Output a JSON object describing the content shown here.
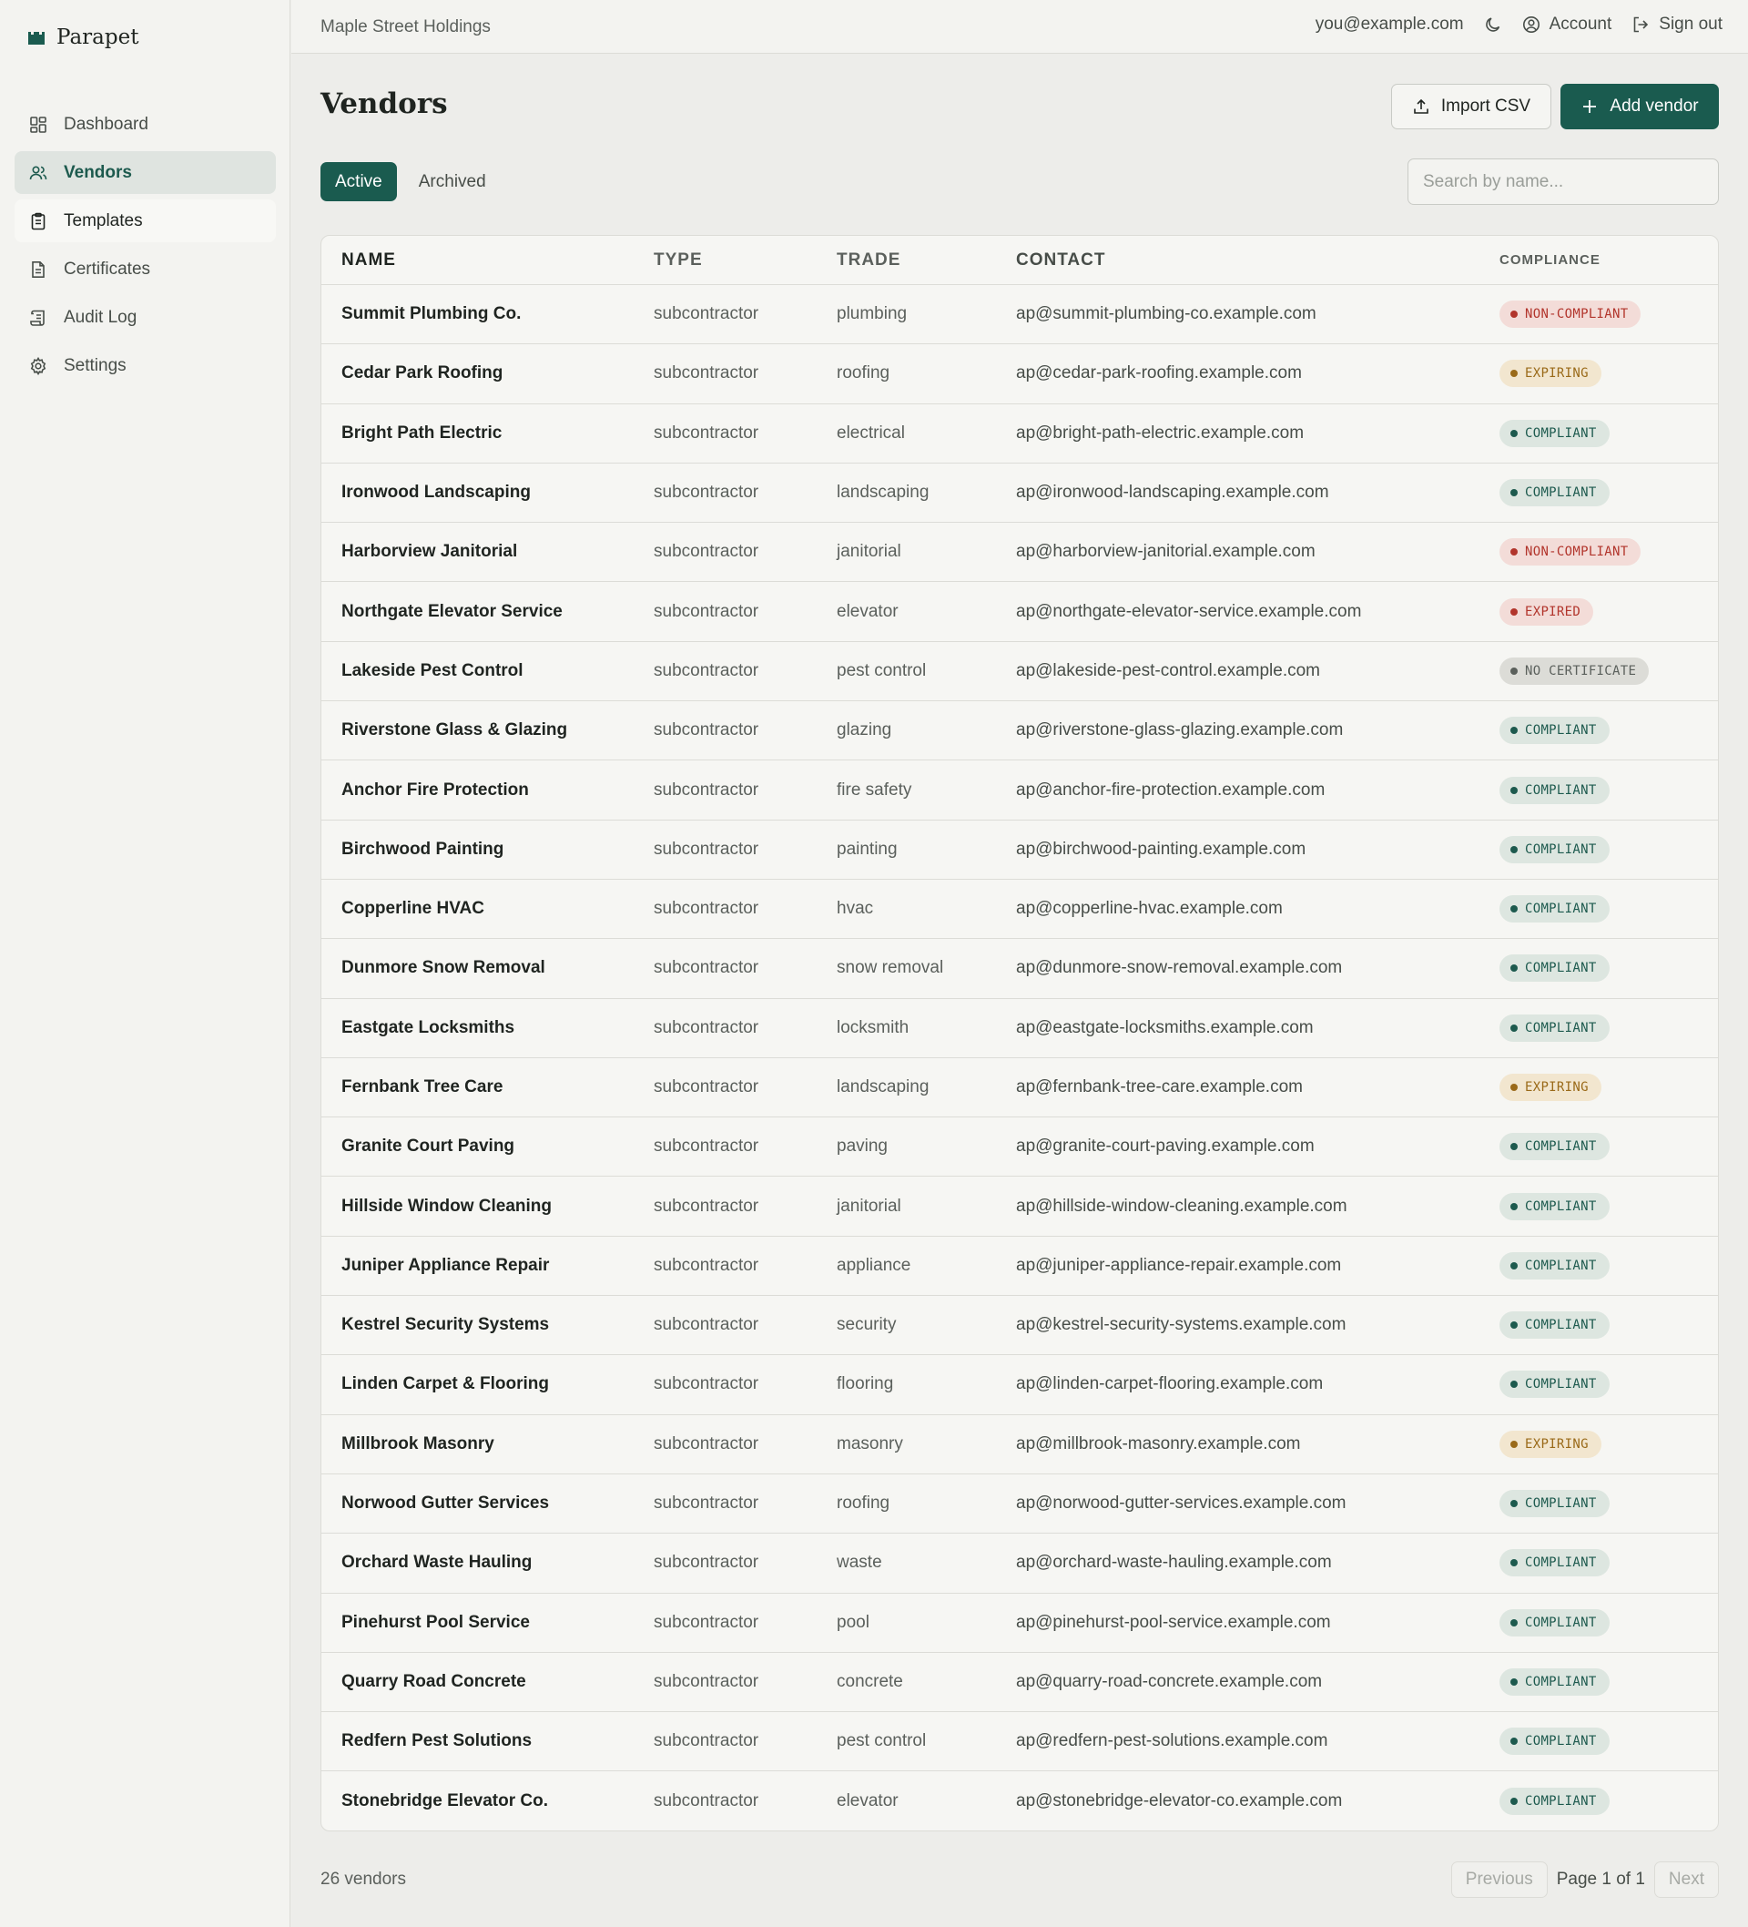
{
  "app": {
    "name": "Parapet",
    "org": "Maple Street Holdings"
  },
  "sidebar": {
    "items": [
      {
        "label": "Dashboard",
        "icon": "dashboard-icon"
      },
      {
        "label": "Vendors",
        "icon": "users-icon"
      },
      {
        "label": "Templates",
        "icon": "clipboard-icon"
      },
      {
        "label": "Certificates",
        "icon": "file-icon"
      },
      {
        "label": "Audit Log",
        "icon": "scroll-icon"
      },
      {
        "label": "Settings",
        "icon": "gear-icon"
      }
    ],
    "active": "Vendors"
  },
  "topbar": {
    "email": "you@example.com",
    "account_label": "Account",
    "signout_label": "Sign out"
  },
  "page": {
    "title": "Vendors",
    "import_label": "Import CSV",
    "add_label": "Add vendor",
    "tabs": [
      "Active",
      "Archived"
    ],
    "active_tab": "Active",
    "search_placeholder": "Search by name..."
  },
  "table": {
    "headers": {
      "name": "NAME",
      "type": "TYPE",
      "trade": "TRADE",
      "contact": "CONTACT",
      "compliance": "COMPLIANCE"
    },
    "rows": [
      {
        "name": "Summit Plumbing Co.",
        "type": "subcontractor",
        "trade": "plumbing",
        "contact": "ap@summit-plumbing-co.example.com",
        "compliance": "NON-COMPLIANT",
        "status": "non"
      },
      {
        "name": "Cedar Park Roofing",
        "type": "subcontractor",
        "trade": "roofing",
        "contact": "ap@cedar-park-roofing.example.com",
        "compliance": "EXPIRING",
        "status": "expiring"
      },
      {
        "name": "Bright Path Electric",
        "type": "subcontractor",
        "trade": "electrical",
        "contact": "ap@bright-path-electric.example.com",
        "compliance": "COMPLIANT",
        "status": "compliant"
      },
      {
        "name": "Ironwood Landscaping",
        "type": "subcontractor",
        "trade": "landscaping",
        "contact": "ap@ironwood-landscaping.example.com",
        "compliance": "COMPLIANT",
        "status": "compliant"
      },
      {
        "name": "Harborview Janitorial",
        "type": "subcontractor",
        "trade": "janitorial",
        "contact": "ap@harborview-janitorial.example.com",
        "compliance": "NON-COMPLIANT",
        "status": "non"
      },
      {
        "name": "Northgate Elevator Service",
        "type": "subcontractor",
        "trade": "elevator",
        "contact": "ap@northgate-elevator-service.example.com",
        "compliance": "EXPIRED",
        "status": "expired"
      },
      {
        "name": "Lakeside Pest Control",
        "type": "subcontractor",
        "trade": "pest control",
        "contact": "ap@lakeside-pest-control.example.com",
        "compliance": "NO CERTIFICATE",
        "status": "nocert"
      },
      {
        "name": "Riverstone Glass & Glazing",
        "type": "subcontractor",
        "trade": "glazing",
        "contact": "ap@riverstone-glass-glazing.example.com",
        "compliance": "COMPLIANT",
        "status": "compliant"
      },
      {
        "name": "Anchor Fire Protection",
        "type": "subcontractor",
        "trade": "fire safety",
        "contact": "ap@anchor-fire-protection.example.com",
        "compliance": "COMPLIANT",
        "status": "compliant"
      },
      {
        "name": "Birchwood Painting",
        "type": "subcontractor",
        "trade": "painting",
        "contact": "ap@birchwood-painting.example.com",
        "compliance": "COMPLIANT",
        "status": "compliant"
      },
      {
        "name": "Copperline HVAC",
        "type": "subcontractor",
        "trade": "hvac",
        "contact": "ap@copperline-hvac.example.com",
        "compliance": "COMPLIANT",
        "status": "compliant"
      },
      {
        "name": "Dunmore Snow Removal",
        "type": "subcontractor",
        "trade": "snow removal",
        "contact": "ap@dunmore-snow-removal.example.com",
        "compliance": "COMPLIANT",
        "status": "compliant"
      },
      {
        "name": "Eastgate Locksmiths",
        "type": "subcontractor",
        "trade": "locksmith",
        "contact": "ap@eastgate-locksmiths.example.com",
        "compliance": "COMPLIANT",
        "status": "compliant"
      },
      {
        "name": "Fernbank Tree Care",
        "type": "subcontractor",
        "trade": "landscaping",
        "contact": "ap@fernbank-tree-care.example.com",
        "compliance": "EXPIRING",
        "status": "expiring"
      },
      {
        "name": "Granite Court Paving",
        "type": "subcontractor",
        "trade": "paving",
        "contact": "ap@granite-court-paving.example.com",
        "compliance": "COMPLIANT",
        "status": "compliant"
      },
      {
        "name": "Hillside Window Cleaning",
        "type": "subcontractor",
        "trade": "janitorial",
        "contact": "ap@hillside-window-cleaning.example.com",
        "compliance": "COMPLIANT",
        "status": "compliant"
      },
      {
        "name": "Juniper Appliance Repair",
        "type": "subcontractor",
        "trade": "appliance",
        "contact": "ap@juniper-appliance-repair.example.com",
        "compliance": "COMPLIANT",
        "status": "compliant"
      },
      {
        "name": "Kestrel Security Systems",
        "type": "subcontractor",
        "trade": "security",
        "contact": "ap@kestrel-security-systems.example.com",
        "compliance": "COMPLIANT",
        "status": "compliant"
      },
      {
        "name": "Linden Carpet & Flooring",
        "type": "subcontractor",
        "trade": "flooring",
        "contact": "ap@linden-carpet-flooring.example.com",
        "compliance": "COMPLIANT",
        "status": "compliant"
      },
      {
        "name": "Millbrook Masonry",
        "type": "subcontractor",
        "trade": "masonry",
        "contact": "ap@millbrook-masonry.example.com",
        "compliance": "EXPIRING",
        "status": "expiring"
      },
      {
        "name": "Norwood Gutter Services",
        "type": "subcontractor",
        "trade": "roofing",
        "contact": "ap@norwood-gutter-services.example.com",
        "compliance": "COMPLIANT",
        "status": "compliant"
      },
      {
        "name": "Orchard Waste Hauling",
        "type": "subcontractor",
        "trade": "waste",
        "contact": "ap@orchard-waste-hauling.example.com",
        "compliance": "COMPLIANT",
        "status": "compliant"
      },
      {
        "name": "Pinehurst Pool Service",
        "type": "subcontractor",
        "trade": "pool",
        "contact": "ap@pinehurst-pool-service.example.com",
        "compliance": "COMPLIANT",
        "status": "compliant"
      },
      {
        "name": "Quarry Road Concrete",
        "type": "subcontractor",
        "trade": "concrete",
        "contact": "ap@quarry-road-concrete.example.com",
        "compliance": "COMPLIANT",
        "status": "compliant"
      },
      {
        "name": "Redfern Pest Solutions",
        "type": "subcontractor",
        "trade": "pest control",
        "contact": "ap@redfern-pest-solutions.example.com",
        "compliance": "COMPLIANT",
        "status": "compliant"
      },
      {
        "name": "Stonebridge Elevator Co.",
        "type": "subcontractor",
        "trade": "elevator",
        "contact": "ap@stonebridge-elevator-co.example.com",
        "compliance": "COMPLIANT",
        "status": "compliant"
      }
    ]
  },
  "footer": {
    "count_label": "26 vendors",
    "prev_label": "Previous",
    "page_label": "Page 1 of 1",
    "next_label": "Next"
  },
  "colors": {
    "accent": "#1a5b4f",
    "compliant": "#1d5a4e",
    "non_compliant": "#b2352c",
    "expiring": "#9a6a19",
    "no_certificate": "#5b605c"
  }
}
